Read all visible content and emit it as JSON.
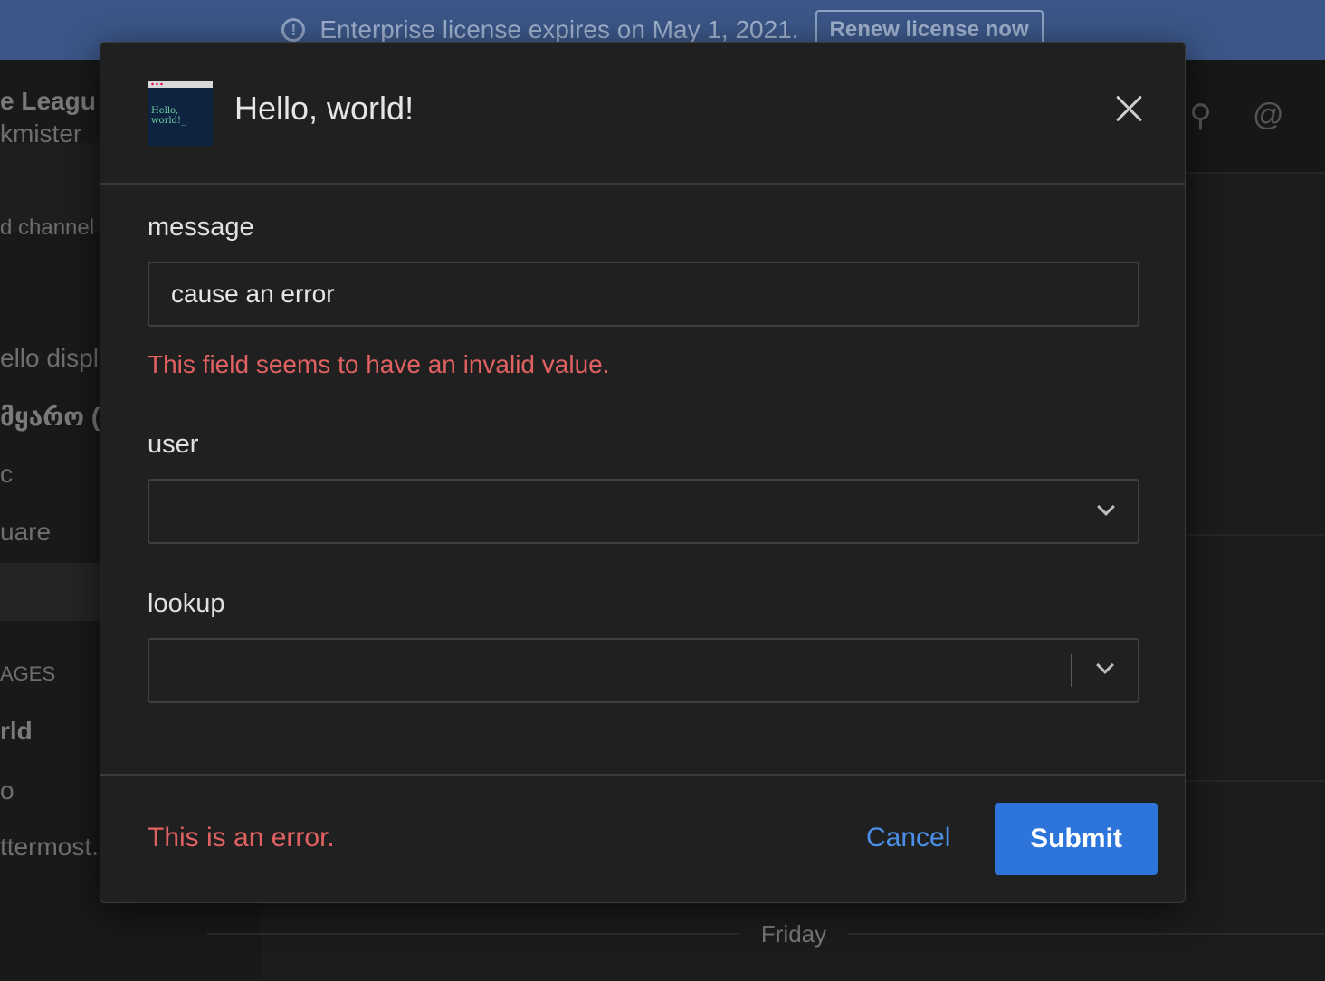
{
  "banner": {
    "message": "Enterprise license expires on May 1, 2021.",
    "button_label": "Renew license now"
  },
  "background": {
    "team_name": "e Leagu",
    "username": "kmister",
    "add_channel": "d channel",
    "channels": [
      "ello displ",
      "მყარო (I",
      "c",
      "uare"
    ],
    "section_header": "AGES",
    "dms": [
      "rld",
      "o",
      "ttermost."
    ],
    "date_separator": "Friday"
  },
  "modal": {
    "title": "Hello, world!",
    "icon_text": "Hello, world!_",
    "fields": {
      "message": {
        "label": "message",
        "value": "cause an error",
        "error": "This field seems to have an invalid value."
      },
      "user": {
        "label": "user",
        "value": ""
      },
      "lookup": {
        "label": "lookup",
        "value": ""
      }
    },
    "footer_error": "This is an error.",
    "cancel_label": "Cancel",
    "submit_label": "Submit"
  },
  "colors": {
    "error": "#e06161",
    "accent": "#2d74db",
    "link": "#4a8fe7",
    "banner": "#3b5687"
  }
}
